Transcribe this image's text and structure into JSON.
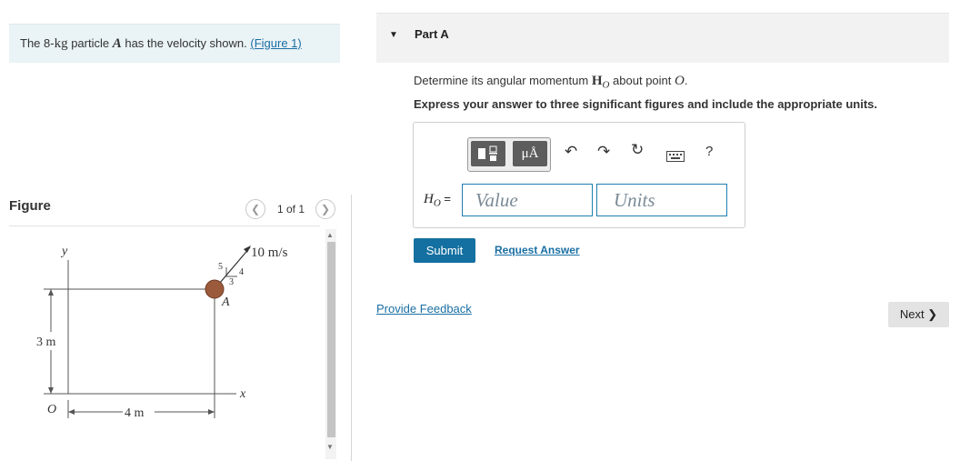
{
  "problem": {
    "intro": "The 8-",
    "unit_kg": "kg",
    "mid": " particle ",
    "particle": "A",
    "tail": " has the velocity shown. ",
    "figure_link": "(Figure 1)"
  },
  "figure_panel": {
    "title": "Figure",
    "page_indicator": "1 of 1",
    "prev_icon": "chevron-left-icon",
    "next_icon": "chevron-right-icon"
  },
  "diagram": {
    "y_axis": "y",
    "x_axis": "x",
    "origin": "O",
    "dim_vertical": "3 m",
    "dim_horizontal": "4 m",
    "velocity": "10 m/s",
    "particle": "A",
    "tri_hyp": "5",
    "tri_vert": "4",
    "tri_horiz": "3"
  },
  "part": {
    "title": "Part A",
    "caret_icon": "caret-down-icon",
    "question_pre": "Determine its angular momentum ",
    "question_sym": "H",
    "question_sub": "O",
    "question_mid": " about point ",
    "question_point": "O",
    "question_end": ".",
    "instruction": "Express your answer to three significant figures and include the appropriate units."
  },
  "answer": {
    "label_h": "H",
    "label_sub": "O",
    "label_eq": " =",
    "value_placeholder": "Value",
    "units_placeholder": "Units",
    "units_tool_label": "μÅ",
    "tools": {
      "templates": "templates-icon",
      "units": "units-icon",
      "undo": "undo-icon",
      "redo": "redo-icon",
      "reset": "reset-icon",
      "keyboard": "keyboard-icon",
      "help": "?"
    },
    "submit": "Submit",
    "request": "Request Answer"
  },
  "feedback_link": "Provide Feedback",
  "next_button": "Next ❯",
  "colors": {
    "link": "#1a6fa3",
    "submit_bg": "#1470a0",
    "input_border": "#1f7eb0",
    "particle": "#9c5a3c"
  }
}
